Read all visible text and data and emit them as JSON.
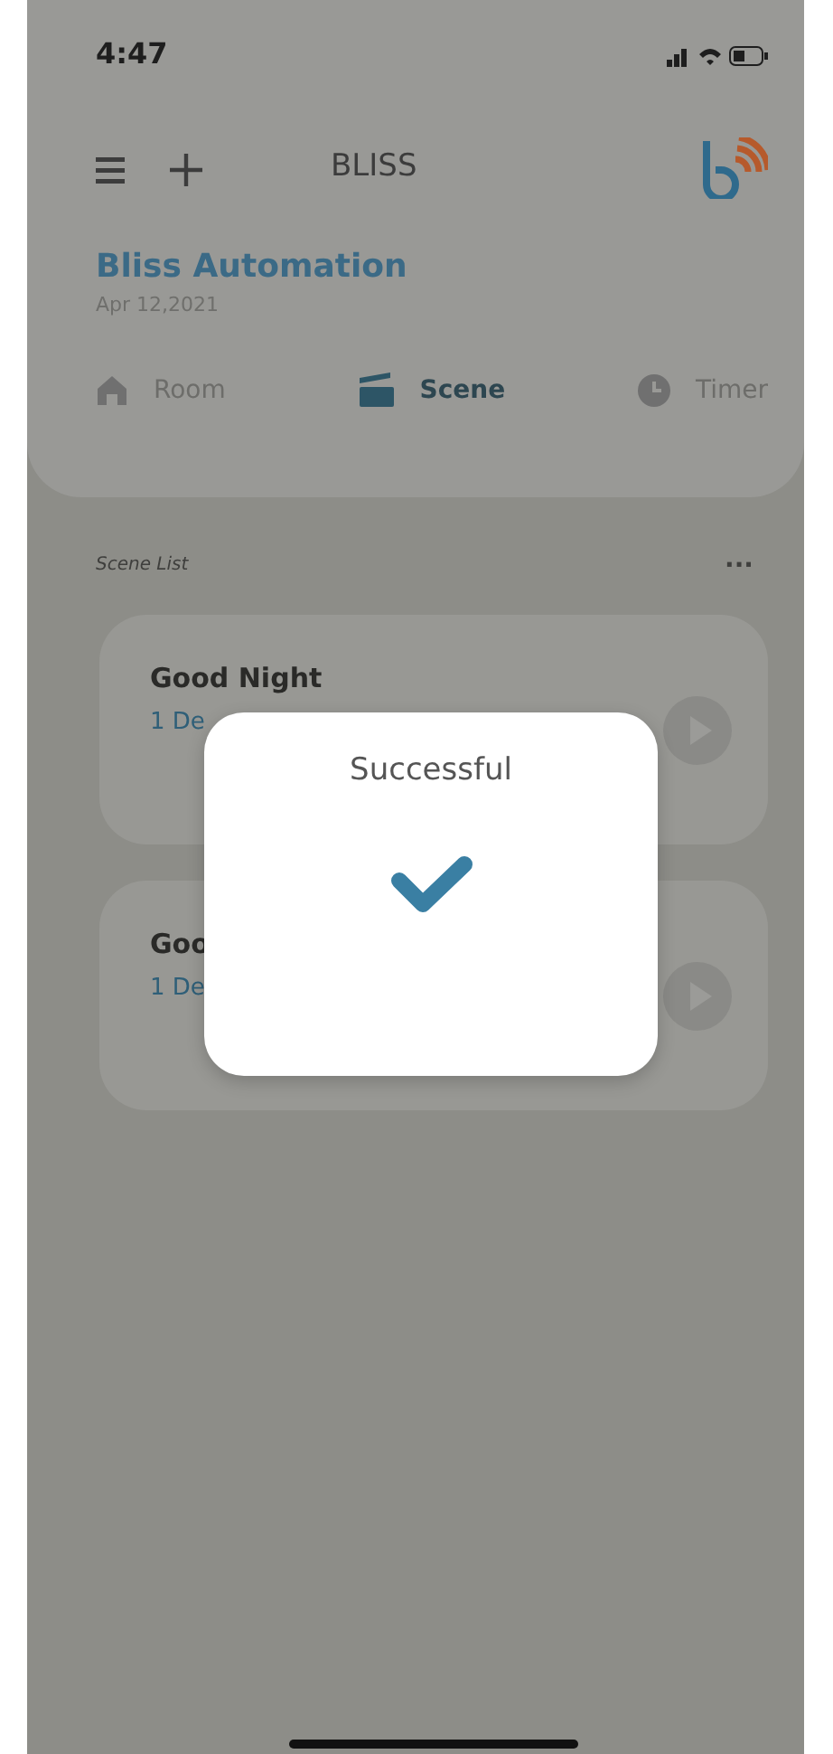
{
  "status_bar": {
    "time": "4:47"
  },
  "header": {
    "title": "BLISS"
  },
  "home": {
    "name": "Bliss Automation",
    "date": "Apr 12,2021"
  },
  "tabs": [
    {
      "label": "Room",
      "selected": false
    },
    {
      "label": "Scene",
      "selected": true
    },
    {
      "label": "Timer",
      "selected": false
    }
  ],
  "scene_list": {
    "heading": "Scene List",
    "more": "···",
    "scenes": [
      {
        "name": "Good Night",
        "devices": "1 De"
      },
      {
        "name": "Goo",
        "devices": "1 De"
      }
    ]
  },
  "dialog": {
    "title": "Successful"
  }
}
